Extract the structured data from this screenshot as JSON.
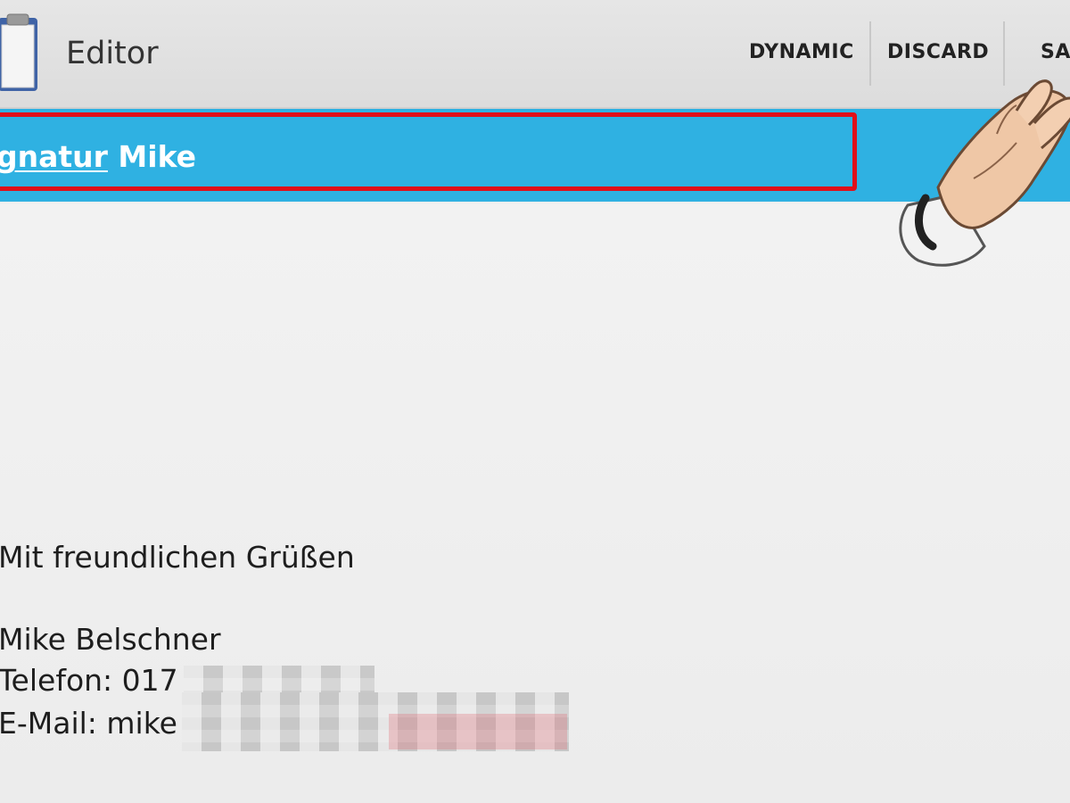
{
  "action_bar": {
    "title": "Editor",
    "actions": {
      "dynamic": "DYNAMIC",
      "discard": "DISCARD",
      "save": "SA"
    }
  },
  "subject": {
    "underlined_part": "gnatur",
    "rest": " Mike"
  },
  "body": {
    "greeting": "Mit freundlichen Grüßen",
    "name": "Mike Belschner",
    "phone": "Telefon: 017",
    "email": "E-Mail: mike"
  },
  "colors": {
    "subject_bar": "#2fb1e2",
    "highlight_border": "#e0101a",
    "background": "#efefef"
  },
  "icons": [
    "clipboard-icon",
    "hand-pointer-icon"
  ]
}
